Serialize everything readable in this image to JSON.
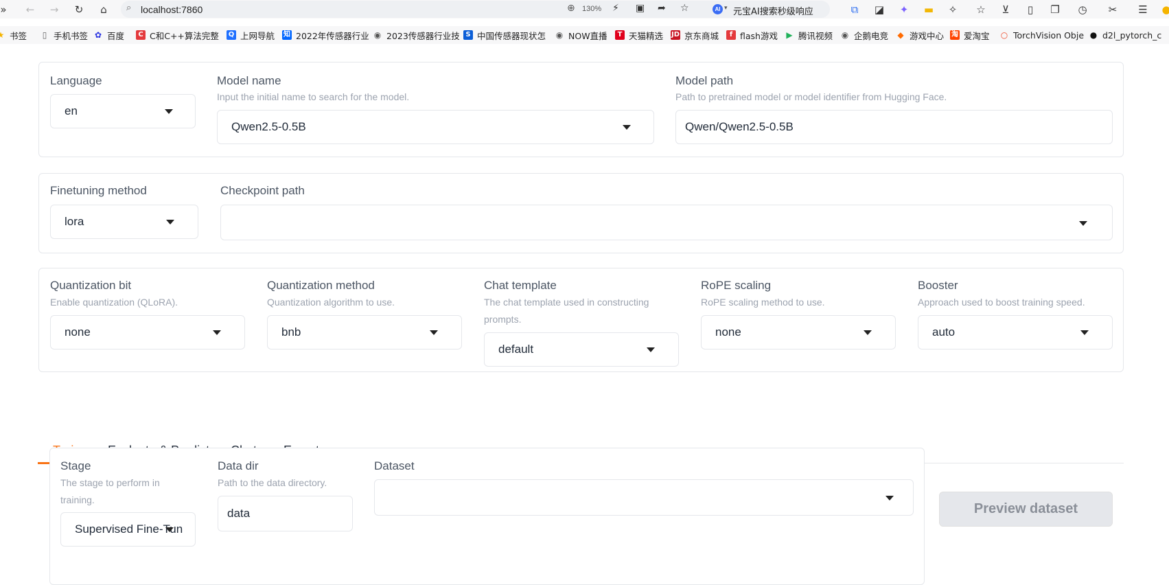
{
  "browser": {
    "url": "localhost:7860",
    "zoom": "130%",
    "ai_search_label": "元宝AI搜索秒级响应",
    "ai_badge": "AI"
  },
  "bookmarks": [
    {
      "label": "书签",
      "icon": "star-icon",
      "color": "#f5b400"
    },
    {
      "label": "手机书签",
      "icon": "phone-icon",
      "color": "#666666"
    },
    {
      "label": "百度",
      "icon": "baidu-icon",
      "color": "#2932e1"
    },
    {
      "label": "C和C++算法完整",
      "icon": "c-icon",
      "color": "#e4393c"
    },
    {
      "label": "上网导航",
      "icon": "q-icon",
      "color": "#1e6fff"
    },
    {
      "label": "2022年传感器行业",
      "icon": "zhihu-icon",
      "color": "#0066ff"
    },
    {
      "label": "2023传感器行业技",
      "icon": "globe-icon",
      "color": "#555555"
    },
    {
      "label": "中国传感器现状怎",
      "icon": "sogou-icon",
      "color": "#0b5ed7"
    },
    {
      "label": "NOW直播",
      "icon": "globe-icon",
      "color": "#555555"
    },
    {
      "label": "天猫精选",
      "icon": "tmall-icon",
      "color": "#e0001b"
    },
    {
      "label": "京东商城",
      "icon": "jd-icon",
      "color": "#c81623"
    },
    {
      "label": "flash游戏",
      "icon": "flash-icon",
      "color": "#e4393c"
    },
    {
      "label": "腾讯视频",
      "icon": "play-icon",
      "color": "#20b15a"
    },
    {
      "label": "企鹅电竞",
      "icon": "globe-icon",
      "color": "#555555"
    },
    {
      "label": "游戏中心",
      "icon": "gamepad-icon",
      "color": "#ff6a00"
    },
    {
      "label": "爱淘宝",
      "icon": "taobao-icon",
      "color": "#ff4400"
    },
    {
      "label": "TorchVision Obje",
      "icon": "pytorch-icon",
      "color": "#ee4c2c"
    },
    {
      "label": "d2l_pytorch_c",
      "icon": "github-icon",
      "color": "#111111"
    }
  ],
  "model": {
    "language": {
      "label": "Language",
      "value": "en"
    },
    "model_name": {
      "label": "Model name",
      "info": "Input the initial name to search for the model.",
      "value": "Qwen2.5-0.5B"
    },
    "model_path": {
      "label": "Model path",
      "info": "Path to pretrained model or model identifier from Hugging Face.",
      "value": "Qwen/Qwen2.5-0.5B"
    }
  },
  "finetune": {
    "method": {
      "label": "Finetuning method",
      "value": "lora"
    },
    "checkpoint": {
      "label": "Checkpoint path",
      "value": ""
    }
  },
  "advanced": {
    "quant_bit": {
      "label": "Quantization bit",
      "info": "Enable quantization (QLoRA).",
      "value": "none"
    },
    "quant_method": {
      "label": "Quantization method",
      "info": "Quantization algorithm to use.",
      "value": "bnb"
    },
    "chat_template": {
      "label": "Chat template",
      "info_line1": "The chat template used in constructing",
      "info_line2": "prompts.",
      "value": "default"
    },
    "rope": {
      "label": "RoPE scaling",
      "info": "RoPE scaling method to use.",
      "value": "none"
    },
    "booster": {
      "label": "Booster",
      "info": "Approach used to boost training speed.",
      "value": "auto"
    }
  },
  "tabs": [
    {
      "label": "Train",
      "active": true
    },
    {
      "label": "Evaluate & Predict",
      "active": false
    },
    {
      "label": "Chat",
      "active": false
    },
    {
      "label": "Export",
      "active": false
    }
  ],
  "train": {
    "stage": {
      "label": "Stage",
      "info_line1": "The stage to perform in",
      "info_line2": "training.",
      "value": "Supervised Fine-Tun"
    },
    "data_dir": {
      "label": "Data dir",
      "info": "Path to the data directory.",
      "value": "data"
    },
    "dataset": {
      "label": "Dataset",
      "value": ""
    },
    "preview_button": "Preview dataset"
  },
  "colors": {
    "accent": "#f97316",
    "border": "#e5e7eb",
    "muted_text": "#9ca3af"
  }
}
